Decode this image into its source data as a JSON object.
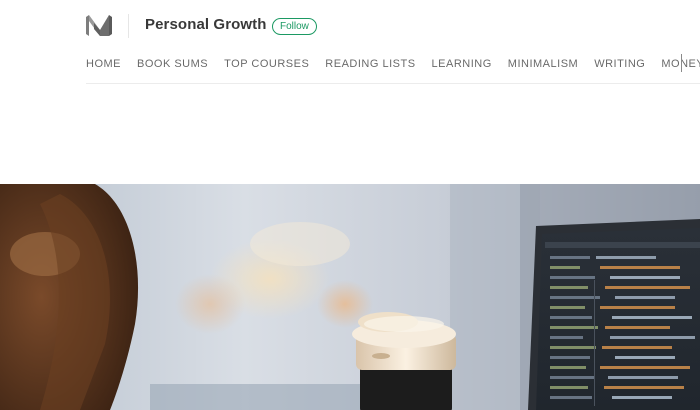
{
  "publication": {
    "title": "Personal Growth",
    "follow_label": "Follow",
    "logo_icon": "medium-logo-icon"
  },
  "nav": {
    "items": [
      {
        "label": "HOME"
      },
      {
        "label": "BOOK SUMS"
      },
      {
        "label": "TOP COURSES"
      },
      {
        "label": "READING LISTS"
      },
      {
        "label": "LEARNING"
      },
      {
        "label": "MINIMALISM"
      },
      {
        "label": "WRITING"
      },
      {
        "label": "MONEY"
      }
    ]
  },
  "colors": {
    "accent": "#1c9963",
    "nav_text": "#666666",
    "divider": "#ececec"
  },
  "hero": {
    "image": "photo of a person with a coffee cup in front of a laptop showing code"
  }
}
